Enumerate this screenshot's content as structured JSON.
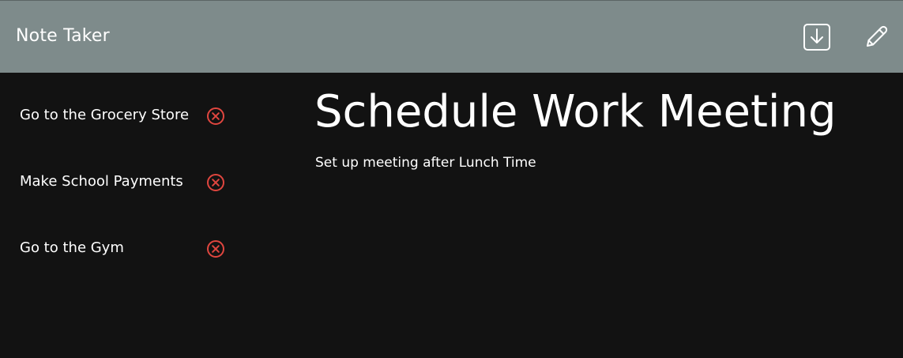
{
  "app": {
    "title": "Note Taker"
  },
  "toolbar": {
    "save_icon": "save-download-icon",
    "edit_icon": "pencil-icon"
  },
  "sidebar": {
    "items": [
      {
        "label": "Go to the Grocery Store",
        "delete_icon": "close-circle-icon"
      },
      {
        "label": "Make School Payments",
        "delete_icon": "close-circle-icon"
      },
      {
        "label": "Go to the Gym",
        "delete_icon": "close-circle-icon"
      }
    ]
  },
  "note": {
    "title": "Schedule Work Meeting",
    "body": "Set up meeting after Lunch Time"
  },
  "colors": {
    "navbar": "#7e8b8b",
    "background": "#121212",
    "text": "#ffffff",
    "delete": "#e0463f"
  }
}
